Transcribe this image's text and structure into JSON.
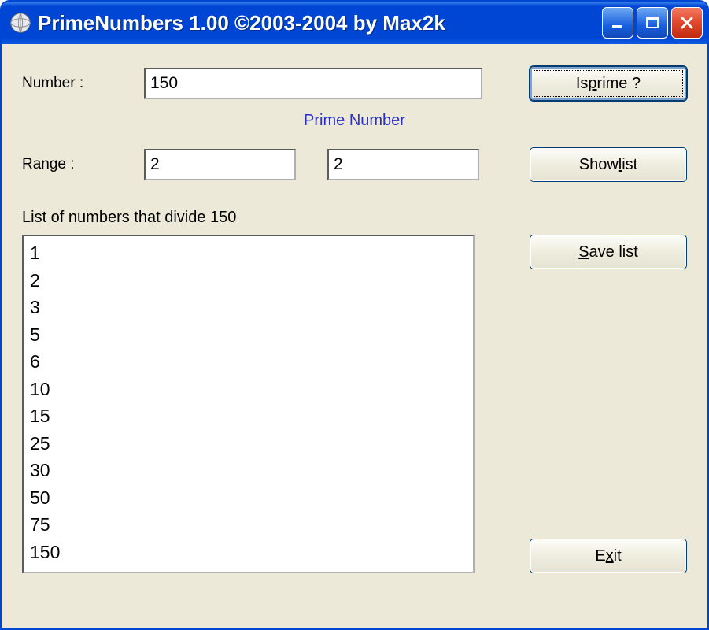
{
  "window": {
    "title": "PrimeNumbers 1.00 ©2003-2004 by Max2k"
  },
  "labels": {
    "number": "Number :",
    "range": "Range :",
    "status": "Prime Number",
    "list_header_prefix": "List of numbers that divide ",
    "list_header_value": "150"
  },
  "inputs": {
    "number_value": "150",
    "range_from": "2",
    "range_to": "2"
  },
  "buttons": {
    "is_prime_pre": "Is ",
    "is_prime_u": "p",
    "is_prime_post": "rime ?",
    "show_list_pre": "Show ",
    "show_list_u": "l",
    "show_list_post": "ist",
    "save_list_u": "S",
    "save_list_post": "ave list",
    "exit_pre": "E",
    "exit_u": "x",
    "exit_post": "it"
  },
  "divisors": [
    "1",
    "2",
    "3",
    "5",
    "6",
    "10",
    "15",
    "25",
    "30",
    "50",
    "75",
    "150"
  ]
}
